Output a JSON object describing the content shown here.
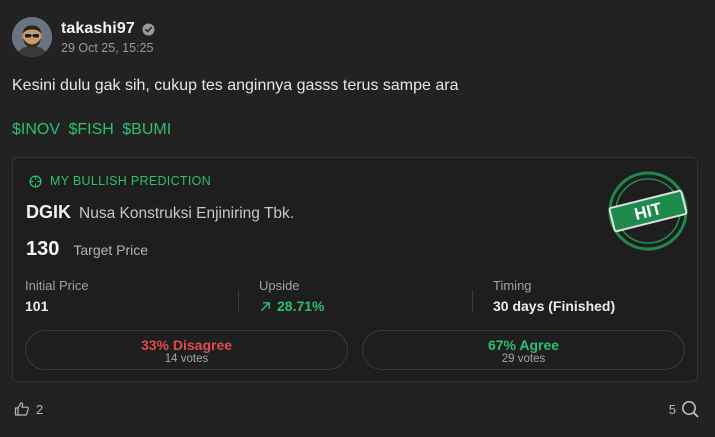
{
  "post": {
    "username": "takashi97",
    "timestamp": "29 Oct 25, 15:25",
    "body": "Kesini dulu gak sih, cukup tes anginnya gasss terus sampe ara",
    "tickers": [
      "$INOV",
      "$FISH",
      "$BUMI"
    ]
  },
  "prediction": {
    "label": "MY BULLISH PREDICTION",
    "stock_code": "DGIK",
    "stock_name": "Nusa Konstruksi Enjiniring Tbk.",
    "target_value": "130",
    "target_label": "Target Price",
    "initial_price_label": "Initial Price",
    "initial_price": "101",
    "upside_label": "Upside",
    "upside": "28.71%",
    "timing_label": "Timing",
    "timing": "30 days (Finished)",
    "stamp_text": "HIT",
    "disagree_label": "33% Disagree",
    "disagree_votes": "14 votes",
    "agree_label": "67% Agree",
    "agree_votes": "29 votes"
  },
  "footer": {
    "likes": "2",
    "replies": "5"
  },
  "colors": {
    "background": "#222222",
    "accent_green": "#2fbf71",
    "disagree_red": "#e24b4b",
    "stamp_green": "#1e8a4c"
  },
  "icons": {
    "verified": "check-badge-icon",
    "prediction": "target-icon",
    "upside": "arrow-up-right-icon",
    "like": "thumbs-up-icon",
    "reply": "search-comment-icon"
  }
}
